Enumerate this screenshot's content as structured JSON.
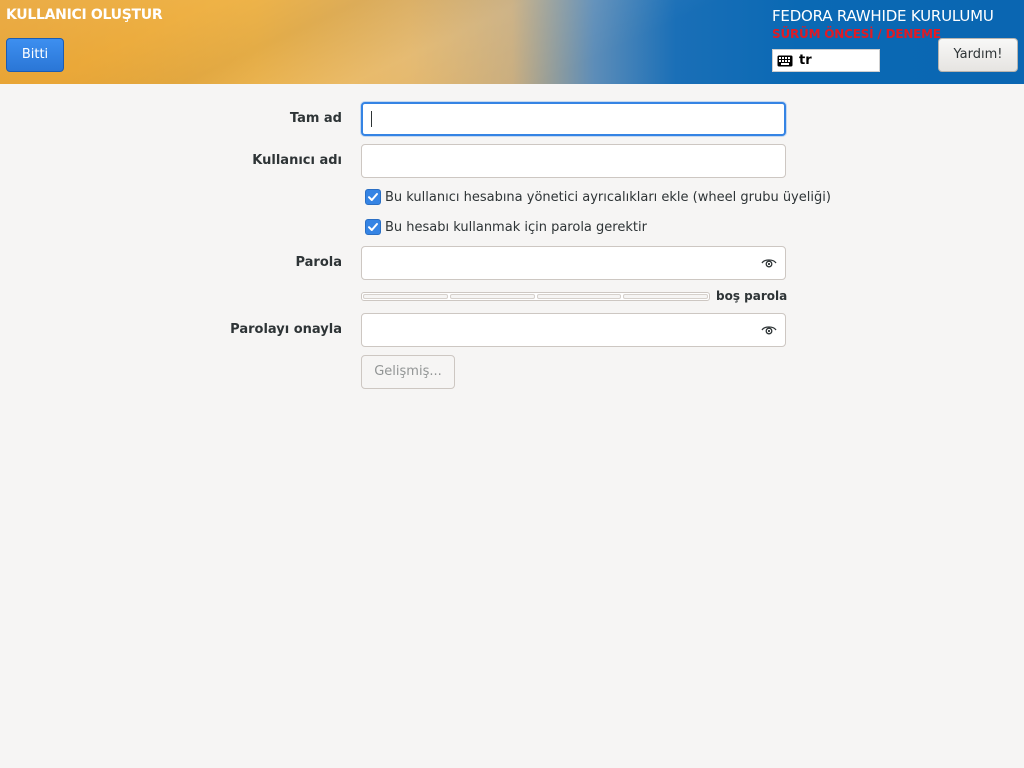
{
  "header": {
    "title": "KULLANICI OLUŞTUR",
    "done_label": "Bitti",
    "product_title": "FEDORA RAWHIDE KURULUMU",
    "prerelease": "SÜRÜM ÖNCESİ / DENEME",
    "keyboard_layout": "tr",
    "help_label": "Yardım!",
    "colors": {
      "done_button": "#3584e4",
      "prerelease_text": "#e01b24",
      "banner_blue": "#0a66b2",
      "banner_orange": "#f0b54a"
    }
  },
  "form": {
    "full_name": {
      "label": "Tam ad",
      "value": ""
    },
    "username": {
      "label": "Kullanıcı adı",
      "value": ""
    },
    "admin_checkbox": {
      "label": "Bu kullanıcı hesabına yönetici ayrıcalıkları ekle (wheel grubu üyeliği)",
      "checked": true
    },
    "require_password_checkbox": {
      "label": "Bu hesabı kullanmak için parola gerektir",
      "checked": true
    },
    "password": {
      "label": "Parola",
      "value": "",
      "reveal_icon": "eye-icon"
    },
    "strength": {
      "label": "boş parola",
      "level": 0
    },
    "confirm_password": {
      "label": "Parolayı onayla",
      "value": "",
      "reveal_icon": "eye-icon"
    },
    "advanced_label": "Gelişmiş..."
  }
}
